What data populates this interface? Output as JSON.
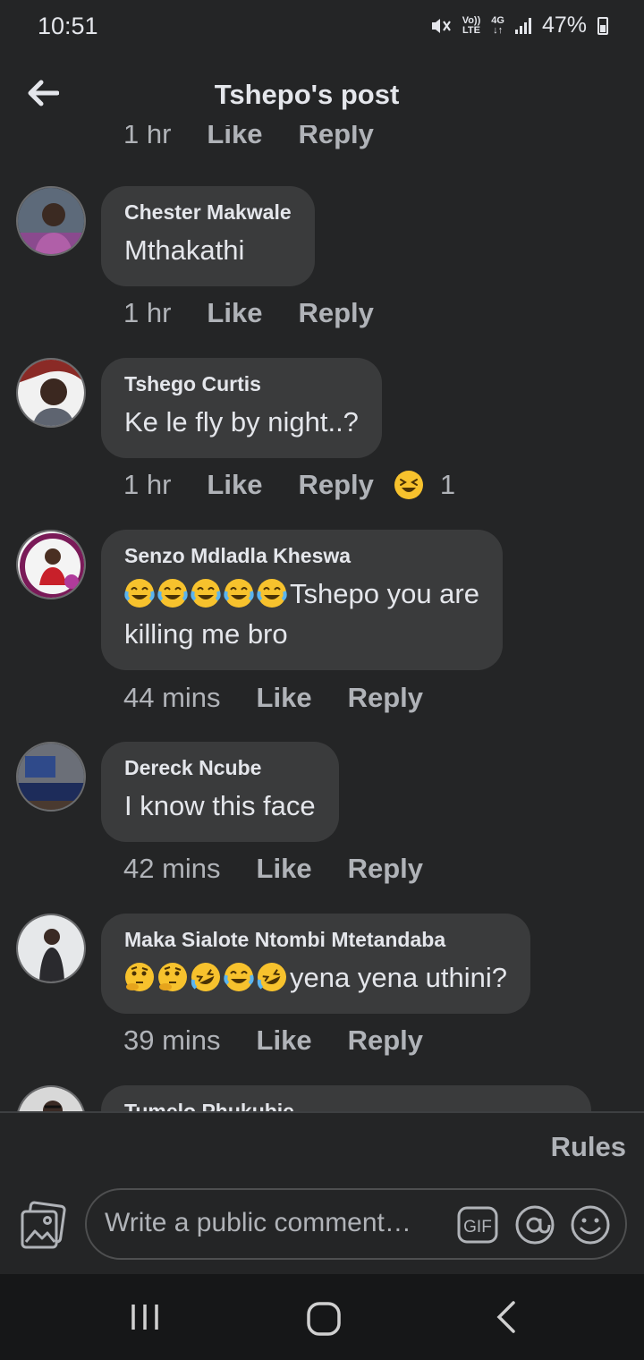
{
  "status_bar": {
    "time": "10:51",
    "network_top": "Vo))",
    "network_bottom": "LTE",
    "data_top": "4G",
    "data_bottom": "↓↑",
    "battery": "47%"
  },
  "header": {
    "title": "Tshepo's post"
  },
  "partial_meta": {
    "time": "1 hr",
    "like": "Like",
    "reply": "Reply"
  },
  "comments": [
    {
      "author": "Chester Makwale",
      "text": "Mthakathi",
      "time": "1 hr",
      "like": "Like",
      "reply": "Reply"
    },
    {
      "author": "Tshego Curtis",
      "text": "Ke le fly by night..?",
      "time": "1 hr",
      "like": "Like",
      "reply": "Reply",
      "reaction_icon": "laughing-squint-icon",
      "reaction_count": "1"
    },
    {
      "author": "Senzo Mdladla Kheswa",
      "emojis": [
        "tears-of-joy",
        "tears-of-joy",
        "tears-of-joy",
        "tears-of-joy",
        "tears-of-joy"
      ],
      "text_line1": "Tshepo you are",
      "text_line2": "killing me bro",
      "time": "44 mins",
      "like": "Like",
      "reply": "Reply"
    },
    {
      "author": "Dereck Ncube",
      "text": "I know this face",
      "time": "42 mins",
      "like": "Like",
      "reply": "Reply"
    },
    {
      "author": "Maka Sialote Ntombi Mtetandaba",
      "emojis": [
        "thinking",
        "thinking",
        "rolling-laughing",
        "tears-of-joy",
        "rolling-laughing"
      ],
      "text": "yena yena uthini?",
      "time": "39 mins",
      "like": "Like",
      "reply": "Reply"
    },
    {
      "author": "Tumelo Phukubje"
    }
  ],
  "footer": {
    "rules": "Rules",
    "placeholder": "Write a public comment…",
    "gif_label": "GIF"
  },
  "colors": {
    "background": "#242526",
    "bubble": "#3a3b3c",
    "primary_text": "#e4e6eb",
    "secondary_text": "#b0b3b8",
    "emoji_yellow": "#f7c22d"
  }
}
